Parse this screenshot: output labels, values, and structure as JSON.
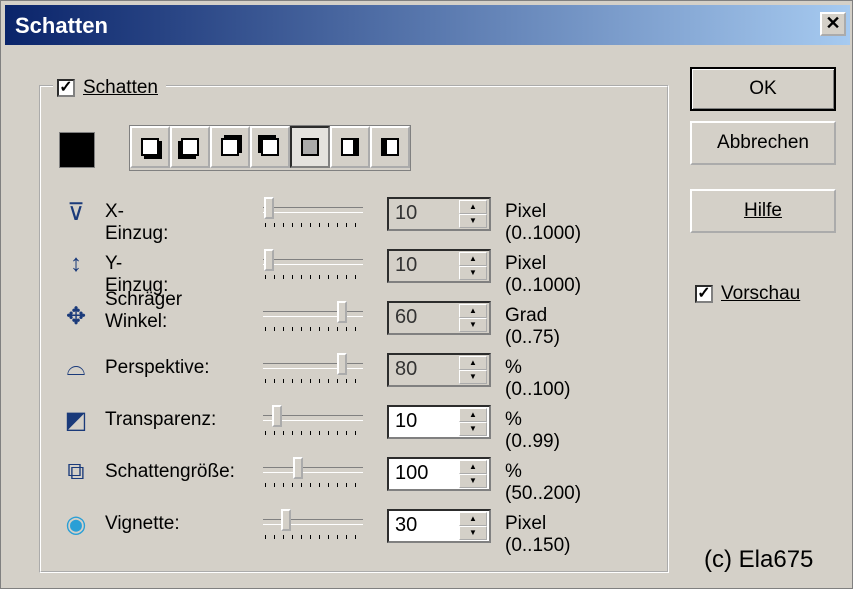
{
  "window": {
    "title": "Schatten",
    "close_glyph": "✕"
  },
  "group": {
    "label": "Schatten",
    "checked": true
  },
  "swatch_color": "#000000",
  "toolbar": {
    "buttons": [
      {
        "name": "shadow-bottom-right-icon"
      },
      {
        "name": "shadow-bottom-left-icon"
      },
      {
        "name": "shadow-top-right-icon"
      },
      {
        "name": "shadow-top-left-icon"
      },
      {
        "name": "shadow-center-icon",
        "active": true
      },
      {
        "name": "shadow-perspective-right-icon"
      },
      {
        "name": "shadow-perspective-left-icon"
      }
    ]
  },
  "rows": [
    {
      "label": "X-Einzug:",
      "value": "10",
      "unit": "Pixel (0..1000)",
      "slider_fraction": 0.01,
      "icon": "x-offset-icon"
    },
    {
      "label": "Y-Einzug:",
      "value": "10",
      "unit": "Pixel (0..1000)",
      "slider_fraction": 0.01,
      "icon": "y-offset-icon"
    },
    {
      "label": "Schräger Winkel:",
      "value": "60",
      "unit": "Grad (0..75)",
      "slider_fraction": 0.8,
      "icon": "angle-icon"
    },
    {
      "label": "Perspektive:",
      "value": "80",
      "unit": "% (0..100)",
      "slider_fraction": 0.8,
      "icon": "perspective-icon"
    },
    {
      "label": "Transparenz:",
      "value": "10",
      "unit": "% (0..99)",
      "slider_fraction": 0.1,
      "icon": "transparency-icon"
    },
    {
      "label": "Schattengröße:",
      "value": "100",
      "unit": "% (50..200)",
      "slider_fraction": 0.33,
      "icon": "shadow-size-icon"
    },
    {
      "label": "Vignette:",
      "value": "30",
      "unit": "Pixel (0..150)",
      "slider_fraction": 0.2,
      "icon": "vignette-icon"
    }
  ],
  "buttons": {
    "ok": "OK",
    "cancel": "Abbrechen",
    "help": "Hilfe"
  },
  "preview": {
    "label": "Vorschau",
    "checked": true
  },
  "watermark": "(c) Ela675"
}
